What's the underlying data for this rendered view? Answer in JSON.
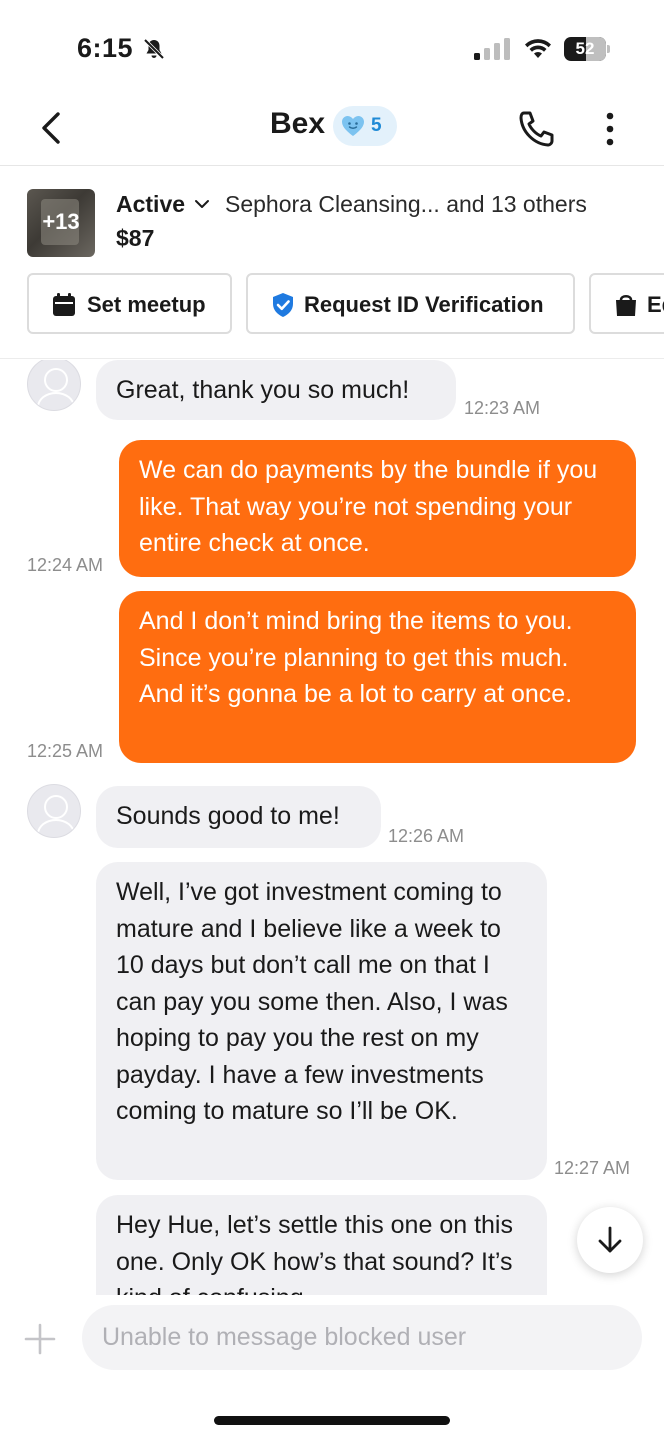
{
  "status_bar": {
    "time": "6:15",
    "battery": "52",
    "icons": [
      "bell-muted-icon",
      "cellular-signal-icon",
      "wifi-icon",
      "battery-icon"
    ]
  },
  "header": {
    "title": "Bex",
    "rating": "5",
    "icons": [
      "chevron-left-icon",
      "heart-face-icon",
      "phone-icon",
      "more-vertical-icon"
    ]
  },
  "listing": {
    "thumb_count": "+13",
    "status": "Active",
    "title": "Sephora Cleansing... and 13 others",
    "price": "$87"
  },
  "actions": {
    "set_meetup": "Set meetup",
    "request_id": "Request ID Verification",
    "third_partial": "Ed"
  },
  "messages": [
    {
      "from": "them",
      "text": "Great, thank you so much!",
      "time": "12:23 AM"
    },
    {
      "from": "me",
      "text": "We can do payments by the bundle if you like. That way you’re not spending your entire check at once.",
      "time": "12:24 AM"
    },
    {
      "from": "me",
      "text": "And I don’t mind bring the items to you. Since you’re planning to get this much. And it’s gonna be a lot to carry at once.",
      "time": "12:25 AM"
    },
    {
      "from": "them",
      "text": "Sounds good to me!",
      "time": "12:26 AM"
    },
    {
      "from": "them",
      "text": "Well, I’ve got investment coming to mature and I believe like a week to 10 days but don’t call me on that I can pay you some then. Also, I was hoping to pay you the rest on my payday. I have a few investments coming to mature so I’ll be OK.",
      "time": "12:27 AM"
    },
    {
      "from": "them",
      "text": "Hey Hue, let’s settle this one on this one. Only OK how’s that sound? It’s kind of confusing",
      "time": ""
    }
  ],
  "composer": {
    "placeholder": "Unable to message blocked user"
  },
  "colors": {
    "outgoing_bubble": "#ff6d10",
    "incoming_bubble": "#f0f0f3",
    "rating_accent": "#1f8ad6",
    "verify_accent": "#1f7ae0"
  }
}
